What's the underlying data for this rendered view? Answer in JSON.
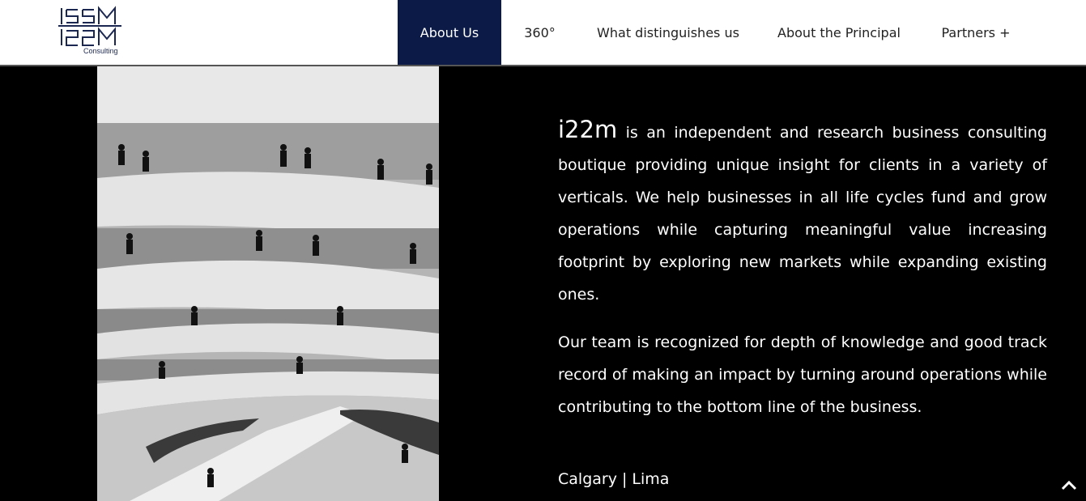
{
  "header": {
    "logo_subtext": "Consulting",
    "nav": [
      {
        "label": "About Us",
        "active": true
      },
      {
        "label": "360°",
        "active": false
      },
      {
        "label": "What distinguishes us",
        "active": false
      },
      {
        "label": "About the Principal",
        "active": false
      },
      {
        "label": "Partners +",
        "active": false
      }
    ]
  },
  "main": {
    "brand": "i22m",
    "paragraph1_rest": " is an independent and research business consulting boutique providing unique insight for clients in a variety of verticals. We help businesses in all life cycles fund and grow operations while capturing meaningful value increasing footprint by exploring new markets while expanding existing ones.",
    "paragraph2": "Our team is recognized for depth of knowledge and good track record of making an impact by turning around operations while contributing to the bottom line of the business.",
    "location": "Calgary | Lima"
  },
  "icons": {
    "scroll_top": "chevron-up-icon"
  },
  "colors": {
    "nav_active_bg": "#0c1a47",
    "page_bg": "#000000",
    "header_bg": "#ffffff"
  }
}
